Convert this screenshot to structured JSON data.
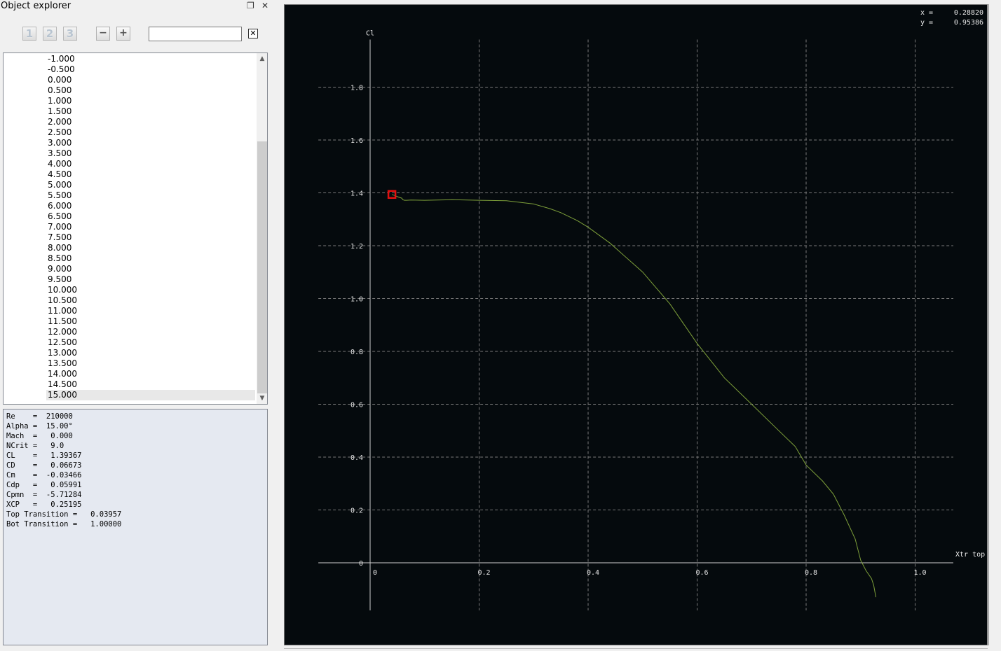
{
  "panel": {
    "title": "Object explorer",
    "float_glyph": "❐",
    "close_glyph": "✕",
    "level_buttons": [
      "1",
      "2",
      "3"
    ],
    "collapse_glyph": "−",
    "expand_glyph": "+",
    "search_value": "",
    "clear_glyph": "✕"
  },
  "tree": {
    "items": [
      "-1.000",
      "-0.500",
      "0.000",
      "0.500",
      "1.000",
      "1.500",
      "2.000",
      "2.500",
      "3.000",
      "3.500",
      "4.000",
      "4.500",
      "5.000",
      "5.500",
      "6.000",
      "6.500",
      "7.000",
      "7.500",
      "8.000",
      "8.500",
      "9.000",
      "9.500",
      "10.000",
      "10.500",
      "11.000",
      "11.500",
      "12.000",
      "12.500",
      "13.000",
      "13.500",
      "14.000",
      "14.500",
      "15.000"
    ],
    "selected": "15.000"
  },
  "properties": {
    "text": "Re    =  210000\nAlpha =  15.00°\nMach  =   0.000\nNCrit =   9.0\nCL    =   1.39367\nCD    =   0.06673\nCm    =  -0.03466\nCdp   =   0.05991\nCpmn  =  -5.71284\nXCP   =   0.25195\nTop Transition =   0.03957\nBot Transition =   1.00000"
  },
  "cursor": {
    "x_label": "x =",
    "x_value": "0.28820",
    "y_label": "y =",
    "y_value": "0.95386"
  },
  "colors": {
    "graph_bg": "#050a0d",
    "curve": "#7ea03a",
    "grid": "#7a7a7a",
    "marker": "#e01010",
    "text": "#e8e8e8"
  },
  "chart_data": {
    "type": "line",
    "xlabel": "Xtr top",
    "ylabel": "Cl",
    "xlim": [
      -0.095,
      1.07
    ],
    "ylim": [
      -0.18,
      1.98
    ],
    "x_ticks": [
      "0",
      "0.2",
      "0.4",
      "0.6",
      "0.8",
      "1.0"
    ],
    "x_tick_values": [
      0,
      0.2,
      0.4,
      0.6,
      0.8,
      1.0
    ],
    "y_ticks": [
      "0",
      "0.2",
      "0.4",
      "0.6",
      "0.8",
      "1.0",
      "1.2",
      "1.4",
      "1.6",
      "1.8"
    ],
    "y_tick_values": [
      0,
      0.2,
      0.4,
      0.6,
      0.8,
      1.0,
      1.2,
      1.4,
      1.6,
      1.8
    ],
    "grid": true,
    "series": [
      {
        "x": [
          0.04,
          0.045,
          0.052,
          0.058,
          0.06,
          0.063,
          0.067,
          0.075,
          0.1,
          0.15,
          0.2,
          0.25,
          0.3,
          0.33,
          0.35,
          0.38,
          0.4,
          0.44,
          0.5,
          0.55,
          0.6,
          0.65,
          0.7,
          0.75,
          0.78,
          0.8,
          0.83,
          0.85,
          0.87,
          0.89,
          0.9,
          0.91,
          0.92,
          0.924,
          0.928
        ],
        "y": [
          1.394,
          1.39,
          1.384,
          1.38,
          1.374,
          1.372,
          1.372,
          1.373,
          1.372,
          1.374,
          1.372,
          1.37,
          1.358,
          1.34,
          1.325,
          1.295,
          1.27,
          1.21,
          1.1,
          0.98,
          0.83,
          0.7,
          0.6,
          0.5,
          0.44,
          0.37,
          0.31,
          0.26,
          0.18,
          0.09,
          0.01,
          -0.03,
          -0.06,
          -0.085,
          -0.13
        ]
      }
    ],
    "marker_point": {
      "x": 0.04,
      "y": 1.394
    }
  }
}
